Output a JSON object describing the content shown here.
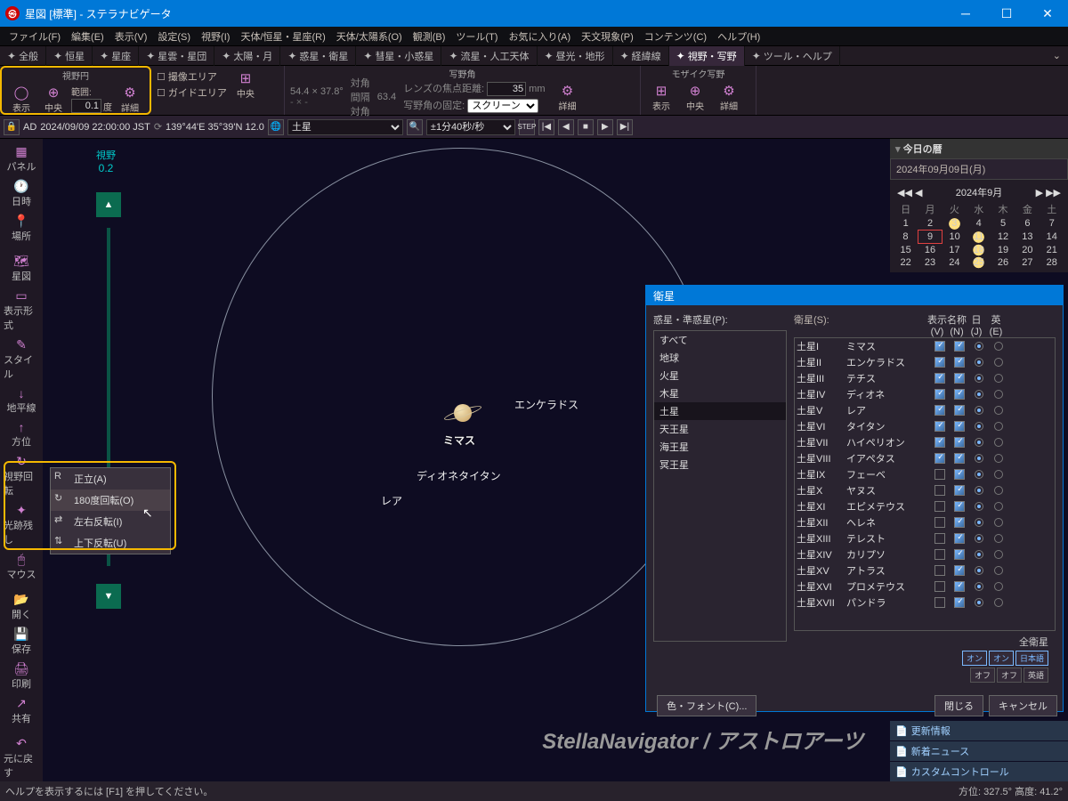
{
  "window": {
    "title": "星図 [標準] - ステラナビゲータ"
  },
  "menubar": [
    "ファイル(F)",
    "編集(E)",
    "表示(V)",
    "設定(S)",
    "視野(I)",
    "天体/恒星・星座(R)",
    "天体/太陽系(O)",
    "観測(B)",
    "ツール(T)",
    "お気に入り(A)",
    "天文現象(P)",
    "コンテンツ(C)",
    "ヘルプ(H)"
  ],
  "tabs": [
    "全般",
    "恒星",
    "星座",
    "星雲・星団",
    "太陽・月",
    "惑星・衛星",
    "彗星・小惑星",
    "流星・人工天体",
    "昼光・地形",
    "経緯線",
    "視野・写野",
    "ツール・ヘルプ"
  ],
  "tabs_active": 10,
  "ribbon": {
    "g1": {
      "label": "視野円",
      "btn1": "表示",
      "btn2": "中央",
      "range_lbl": "範囲:",
      "range_val": "0.1",
      "unit": "度",
      "detail": "詳細"
    },
    "g2": {
      "l1": "撮像エリア",
      "l2": "ガイドエリア",
      "btn": "中央"
    },
    "g3": {
      "label": "写野角",
      "dim": "54.4 × 37.8°",
      "diag_lbl": "対角",
      "diag": "63.4",
      "gap_lbl": "間隔",
      "gap_val": "",
      "focal_lbl": "レンズの焦点距離:",
      "focal_val": "35",
      "mm": "mm",
      "fix_lbl": "写野角の固定:",
      "fix_val": "スクリーン",
      "detail": "詳細"
    },
    "g4": {
      "label": "モザイク写野",
      "b1": "表示",
      "b2": "中央",
      "b3": "詳細"
    }
  },
  "timeline": {
    "ad": "AD",
    "date": "2024/09/09 22:00:00 JST",
    "loc": "139°44'E 35°39'N 12.0",
    "target": "土星",
    "step": "±1分40秒/秒"
  },
  "sidetools": [
    "パネル",
    "日時",
    "場所",
    "",
    "星図",
    "表示形式",
    "スタイル",
    "地平線",
    "方位",
    "視野回転",
    "光跡残し",
    "マウス",
    "",
    "開く",
    "保存",
    "印刷",
    "共有",
    "",
    "元に戻す"
  ],
  "fov": {
    "label": "視野",
    "value": "0.2"
  },
  "sky_labels": {
    "enceladus": "エンケラドス",
    "mimas": "ミマス",
    "dione_titan": "ディオネタイタン",
    "rhea": "レア"
  },
  "ctxmenu": {
    "items": [
      {
        "icon": "R",
        "label": "正立(A)"
      },
      {
        "icon": "↻",
        "label": "180度回転(O)",
        "hover": true
      },
      {
        "icon": "⇄",
        "label": "左右反転(I)"
      },
      {
        "icon": "⇅",
        "label": "上下反転(U)"
      }
    ]
  },
  "calendar": {
    "title": "今日の暦",
    "date": "2024年09月09日(月)",
    "month": "2024年9月",
    "dow": [
      "日",
      "月",
      "火",
      "水",
      "木",
      "金",
      "土"
    ],
    "weeks": [
      [
        "1",
        "2",
        "3",
        "4",
        "5",
        "6",
        "7"
      ],
      [
        "8",
        "9",
        "10",
        "11",
        "12",
        "13",
        "14"
      ],
      [
        "15",
        "16",
        "17",
        "18",
        "19",
        "20",
        "21"
      ],
      [
        "22",
        "23",
        "24",
        "25",
        "26",
        "27",
        "28"
      ]
    ],
    "today": "9"
  },
  "rp_links": [
    "更新情報",
    "新着ニュース",
    "カスタムコントロール"
  ],
  "sat_dialog": {
    "title": "衛星",
    "planets_lbl": "惑星・準惑星(P):",
    "planets": [
      "すべて",
      "地球",
      "火星",
      "木星",
      "土星",
      "天王星",
      "海王星",
      "冥王星"
    ],
    "planets_sel": "土星",
    "sat_lbl": "衛星(S):",
    "cols": {
      "v": "表示",
      "n": "名称",
      "j": "日",
      "e": "英"
    },
    "col_sub": {
      "v": "(V)",
      "n": "(N)",
      "j": "(J)",
      "e": "(E)"
    },
    "rows": [
      {
        "num": "土星I",
        "name": "ミマス",
        "v": true,
        "n": true,
        "jr": true,
        "er": false
      },
      {
        "num": "土星II",
        "name": "エンケラドス",
        "v": true,
        "n": true,
        "jr": true,
        "er": false
      },
      {
        "num": "土星III",
        "name": "テチス",
        "v": true,
        "n": true,
        "jr": true,
        "er": false
      },
      {
        "num": "土星IV",
        "name": "ディオネ",
        "v": true,
        "n": true,
        "jr": true,
        "er": false
      },
      {
        "num": "土星V",
        "name": "レア",
        "v": true,
        "n": true,
        "jr": true,
        "er": false
      },
      {
        "num": "土星VI",
        "name": "タイタン",
        "v": true,
        "n": true,
        "jr": true,
        "er": false
      },
      {
        "num": "土星VII",
        "name": "ハイペリオン",
        "v": true,
        "n": true,
        "jr": true,
        "er": false
      },
      {
        "num": "土星VIII",
        "name": "イアペタス",
        "v": true,
        "n": true,
        "jr": true,
        "er": false
      },
      {
        "num": "土星IX",
        "name": "フェーベ",
        "v": false,
        "n": true,
        "jr": true,
        "er": false
      },
      {
        "num": "土星X",
        "name": "ヤヌス",
        "v": false,
        "n": true,
        "jr": true,
        "er": false
      },
      {
        "num": "土星XI",
        "name": "エピメテウス",
        "v": false,
        "n": true,
        "jr": true,
        "er": false
      },
      {
        "num": "土星XII",
        "name": "ヘレネ",
        "v": false,
        "n": true,
        "jr": true,
        "er": false
      },
      {
        "num": "土星XIII",
        "name": "テレスト",
        "v": false,
        "n": true,
        "jr": true,
        "er": false
      },
      {
        "num": "土星XIV",
        "name": "カリプソ",
        "v": false,
        "n": true,
        "jr": true,
        "er": false
      },
      {
        "num": "土星XV",
        "name": "アトラス",
        "v": false,
        "n": true,
        "jr": true,
        "er": false
      },
      {
        "num": "土星XVI",
        "name": "プロメテウス",
        "v": false,
        "n": true,
        "jr": true,
        "er": false
      },
      {
        "num": "土星XVII",
        "name": "パンドラ",
        "v": false,
        "n": true,
        "jr": true,
        "er": false
      }
    ],
    "all_label": "全衛星",
    "tog_on": "オン",
    "tog_off": "オフ",
    "tog_jp": "日本語",
    "tog_en": "英語",
    "color_font": "色・フォント(C)...",
    "close": "閉じる",
    "cancel": "キャンセル"
  },
  "watermark": "StellaNavigator / アストロアーツ",
  "status": {
    "help": "ヘルプを表示するには [F1] を押してください。",
    "coords": "方位: 327.5° 高度: 41.2°"
  }
}
